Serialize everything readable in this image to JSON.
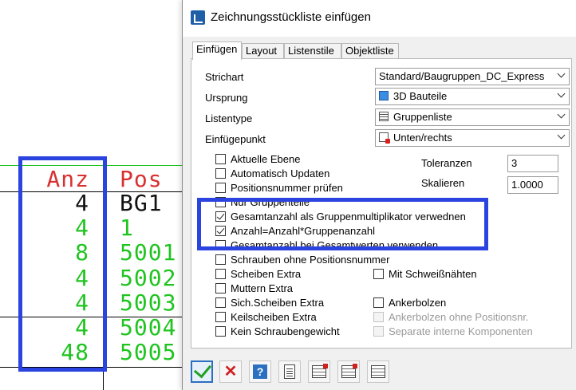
{
  "cad": {
    "headers": {
      "anz": "Anz",
      "pos": "Pos"
    },
    "rows": [
      {
        "anz": "4",
        "pos": "BG1",
        "color": "#111111"
      },
      {
        "anz": "4",
        "pos": "1",
        "color": "#1fc41f"
      },
      {
        "anz": "8",
        "pos": "5001",
        "color": "#1fc41f"
      },
      {
        "anz": "4",
        "pos": "5002",
        "color": "#1fc41f"
      },
      {
        "anz": "4",
        "pos": "5003",
        "color": "#1fc41f"
      },
      {
        "anz": "4",
        "pos": "5004",
        "color": "#1fc41f"
      },
      {
        "anz": "48",
        "pos": "5005",
        "color": "#1fc41f"
      }
    ],
    "highlight_color": "#2b44e0"
  },
  "dialog": {
    "title": "Zeichnungsstückliste einfügen",
    "tabs": [
      "Einfügen",
      "Layout",
      "Listenstile",
      "Objektliste"
    ],
    "fields": {
      "strichart": {
        "label": "Strichart",
        "value": "Standard/Baugruppen_DC_Express"
      },
      "ursprung": {
        "label": "Ursprung",
        "value": "3D Bauteile",
        "icon": "cube-icon"
      },
      "listentype": {
        "label": "Listentype",
        "value": "Gruppenliste",
        "icon": "list-icon"
      },
      "einfuegepunkt": {
        "label": "Einfügepunkt",
        "value": "Unten/rechts",
        "icon": "position-icon"
      }
    },
    "toleranzen": {
      "label": "Toleranzen",
      "value": "3"
    },
    "skalieren": {
      "label": "Skalieren",
      "value": "1.0000"
    },
    "checkboxes_left": [
      {
        "label": "Aktuelle Ebene",
        "checked": false
      },
      {
        "label": "Automatisch Updaten",
        "checked": false
      },
      {
        "label": "Positionsnummer prüfen",
        "checked": false
      },
      {
        "label": "Nur Gruppenteile",
        "checked": false
      },
      {
        "label": "Gesamtanzahl als Gruppenmultiplikator verwednen",
        "checked": true
      },
      {
        "label": "Anzahl=Anzahl*Gruppenanzahl",
        "checked": true
      },
      {
        "label": "Gesamtanzahl bei Gesamtwerten verwenden",
        "checked": false
      },
      {
        "label": "Schrauben ohne Positionsnummer",
        "checked": false
      },
      {
        "label": "Scheiben Extra",
        "checked": false
      },
      {
        "label": "Muttern Extra",
        "checked": false
      },
      {
        "label": "Sich.Scheiben Extra",
        "checked": false
      },
      {
        "label": "Keilscheiben Extra",
        "checked": false
      },
      {
        "label": "Kein Schraubengewicht",
        "checked": false
      }
    ],
    "checkboxes_right": [
      {
        "label": "Mit Schweißnähten",
        "checked": false,
        "disabled": false
      },
      {
        "label": "Ankerbolzen",
        "checked": false,
        "disabled": false
      },
      {
        "label": "Ankerbolzen ohne Positionsnr.",
        "checked": false,
        "disabled": true
      },
      {
        "label": "Separate interne Komponenten",
        "checked": false,
        "disabled": true
      }
    ],
    "toolbar": [
      "ok-check-icon",
      "cancel-x-icon",
      "help-icon",
      "document-icon",
      "table-check-icon",
      "table-remove-icon",
      "table-icon"
    ]
  }
}
